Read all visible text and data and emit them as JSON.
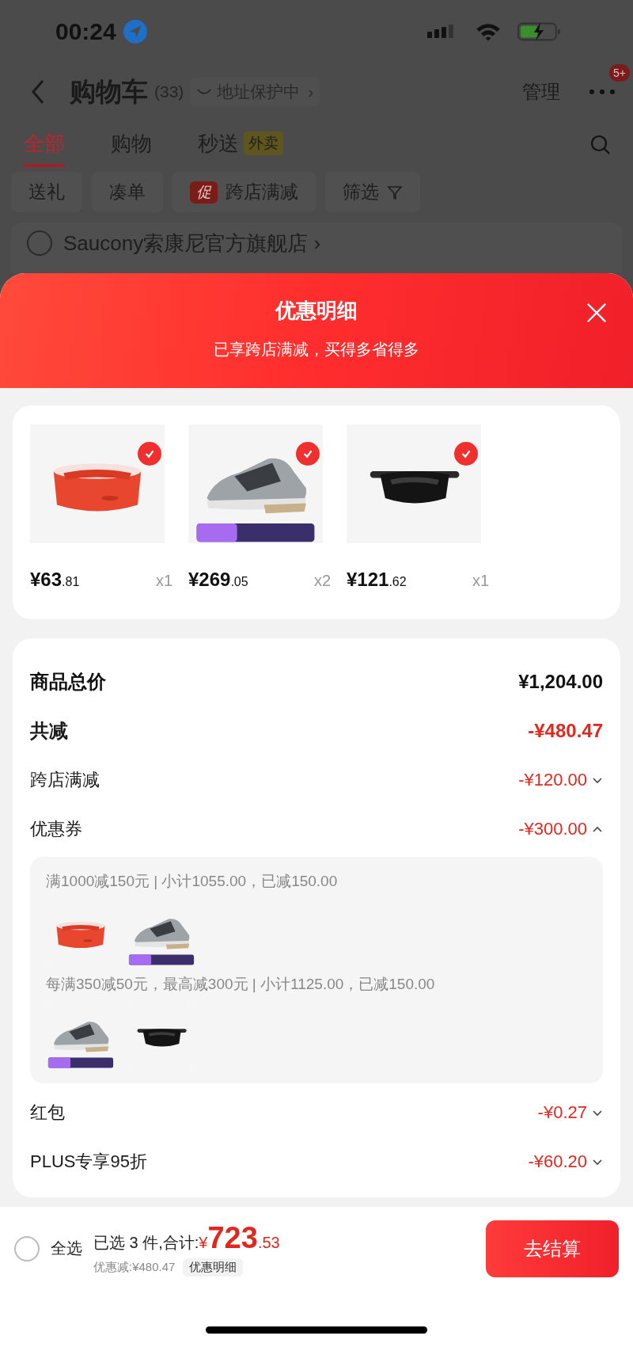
{
  "status_bar": {
    "time": "00:24"
  },
  "header": {
    "title": "购物车",
    "count": "(33)",
    "address": "地址保护中",
    "address_chevron": "›",
    "manage": "管理",
    "badge": "5+"
  },
  "tabs": [
    {
      "label": "全部",
      "selected": true
    },
    {
      "label": "购物",
      "selected": false
    },
    {
      "label": "秒送",
      "selected": false,
      "badge": "外卖"
    }
  ],
  "chips": [
    {
      "kind": "plain",
      "label": "送礼"
    },
    {
      "kind": "plain",
      "label": "凑单"
    },
    {
      "kind": "promo",
      "tag": "促",
      "label": "跨店满减"
    },
    {
      "kind": "filter",
      "label": "筛选"
    }
  ],
  "store": {
    "name": "Saucony索康尼官方旗舰店",
    "chevron": "›",
    "checked": false
  },
  "sheet": {
    "title": "优惠明细",
    "subtitle": "已享跨店满减，买得多省得多"
  },
  "products": [
    {
      "price": "¥63",
      "decimals": ".81",
      "qty": "x1",
      "checked": true
    },
    {
      "price": "¥269",
      "decimals": ".05",
      "qty": "x2",
      "checked": true
    },
    {
      "price": "¥121",
      "decimals": ".62",
      "qty": "x1",
      "checked": true
    }
  ],
  "summary": [
    {
      "kind": "total",
      "label": "商品总价",
      "value": "¥1,204.00"
    },
    {
      "kind": "reduction",
      "label": "共减",
      "value": "-¥480.47"
    },
    {
      "kind": "discount",
      "label": "跨店满减",
      "value": "-¥120.00",
      "expanded": false
    },
    {
      "kind": "discount",
      "label": "优惠券",
      "value": "-¥300.00",
      "expanded": true,
      "groups": [
        {
          "rule": "满1000减150元 | 小计1055.00，已减150.00"
        },
        {
          "rule": "每满350减50元，最高减300元 | 小计1125.00，已减150.00"
        }
      ]
    },
    {
      "kind": "discount",
      "label": "红包",
      "value": "-¥0.27",
      "expanded": false
    },
    {
      "kind": "discount",
      "label": "PLUS专享95折",
      "value": "-¥60.20",
      "expanded": false
    }
  ],
  "footer": {
    "select_all": "全选",
    "checked": false,
    "selected_text": "已选 3 件,合计:",
    "currency": "¥",
    "amount": "723",
    "decimals": ".53",
    "saved": "优惠减:¥480.47",
    "details": "优惠明细",
    "checkout": "去结算"
  }
}
